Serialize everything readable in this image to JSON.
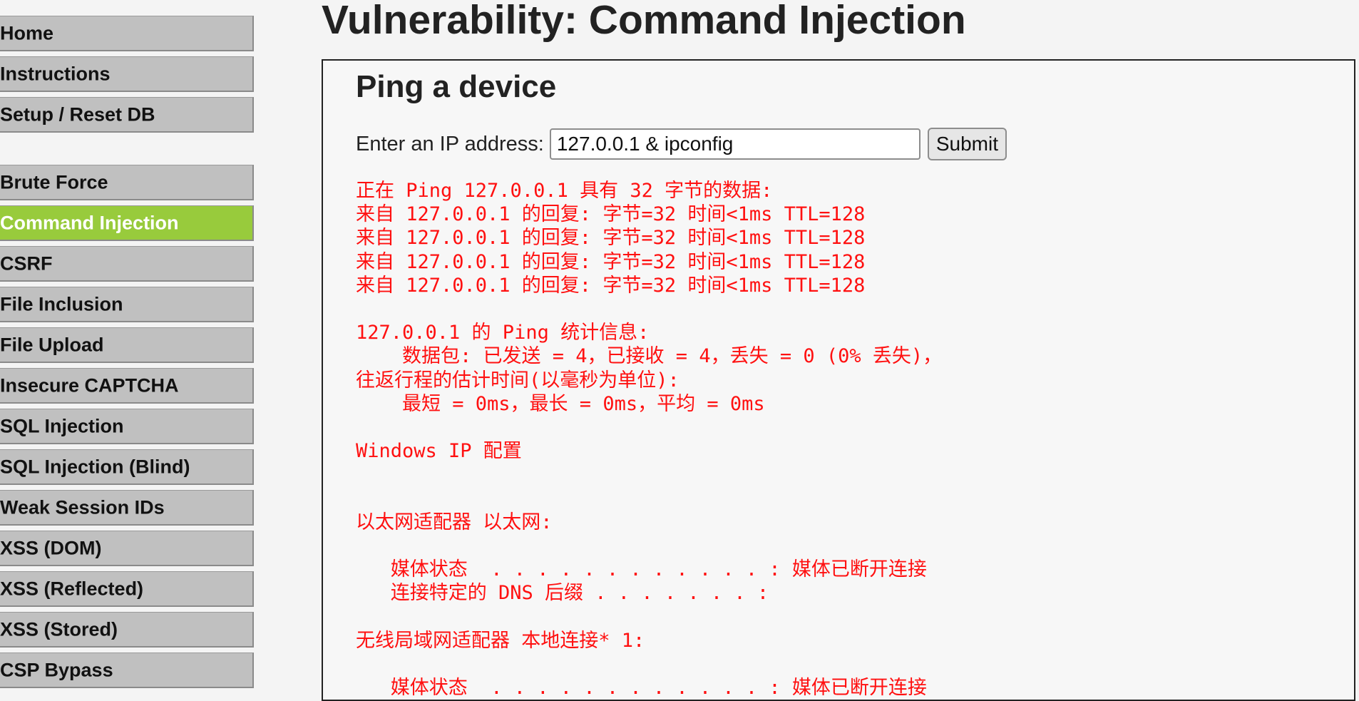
{
  "menu": {
    "group1": [
      "Home",
      "Instructions",
      "Setup / Reset DB"
    ],
    "group2": [
      "Brute Force",
      "Command Injection",
      "CSRF",
      "File Inclusion",
      "File Upload",
      "Insecure CAPTCHA",
      "SQL Injection",
      "SQL Injection (Blind)",
      "Weak Session IDs",
      "XSS (DOM)",
      "XSS (Reflected)",
      "XSS (Stored)",
      "CSP Bypass"
    ],
    "active": "Command Injection",
    "active_color": "#98cb3c"
  },
  "page": {
    "title": "Vulnerability: Command Injection"
  },
  "panel": {
    "heading": "Ping a device",
    "ip_label": "Enter an IP address:",
    "ip_value": "127.0.0.1 & ipconfig",
    "submit_label": "Submit",
    "output_lines": [
      "正在 Ping 127.0.0.1 具有 32 字节的数据:",
      "来自 127.0.0.1 的回复: 字节=32 时间<1ms TTL=128",
      "来自 127.0.0.1 的回复: 字节=32 时间<1ms TTL=128",
      "来自 127.0.0.1 的回复: 字节=32 时间<1ms TTL=128",
      "来自 127.0.0.1 的回复: 字节=32 时间<1ms TTL=128",
      "",
      "127.0.0.1 的 Ping 统计信息:",
      "    数据包: 已发送 = 4，已接收 = 4，丢失 = 0 (0% 丢失)，",
      "往返行程的估计时间(以毫秒为单位):",
      "    最短 = 0ms，最长 = 0ms，平均 = 0ms",
      "",
      "Windows IP 配置",
      "",
      "",
      "以太网适配器 以太网:",
      "",
      "   媒体状态  . . . . . . . . . . . . : 媒体已断开连接",
      "   连接特定的 DNS 后缀 . . . . . . . :",
      "",
      "无线局域网适配器 本地连接* 1:",
      "",
      "   媒体状态  . . . . . . . . . . . . : 媒体已断开连接"
    ],
    "output_color": "#ff1010"
  }
}
